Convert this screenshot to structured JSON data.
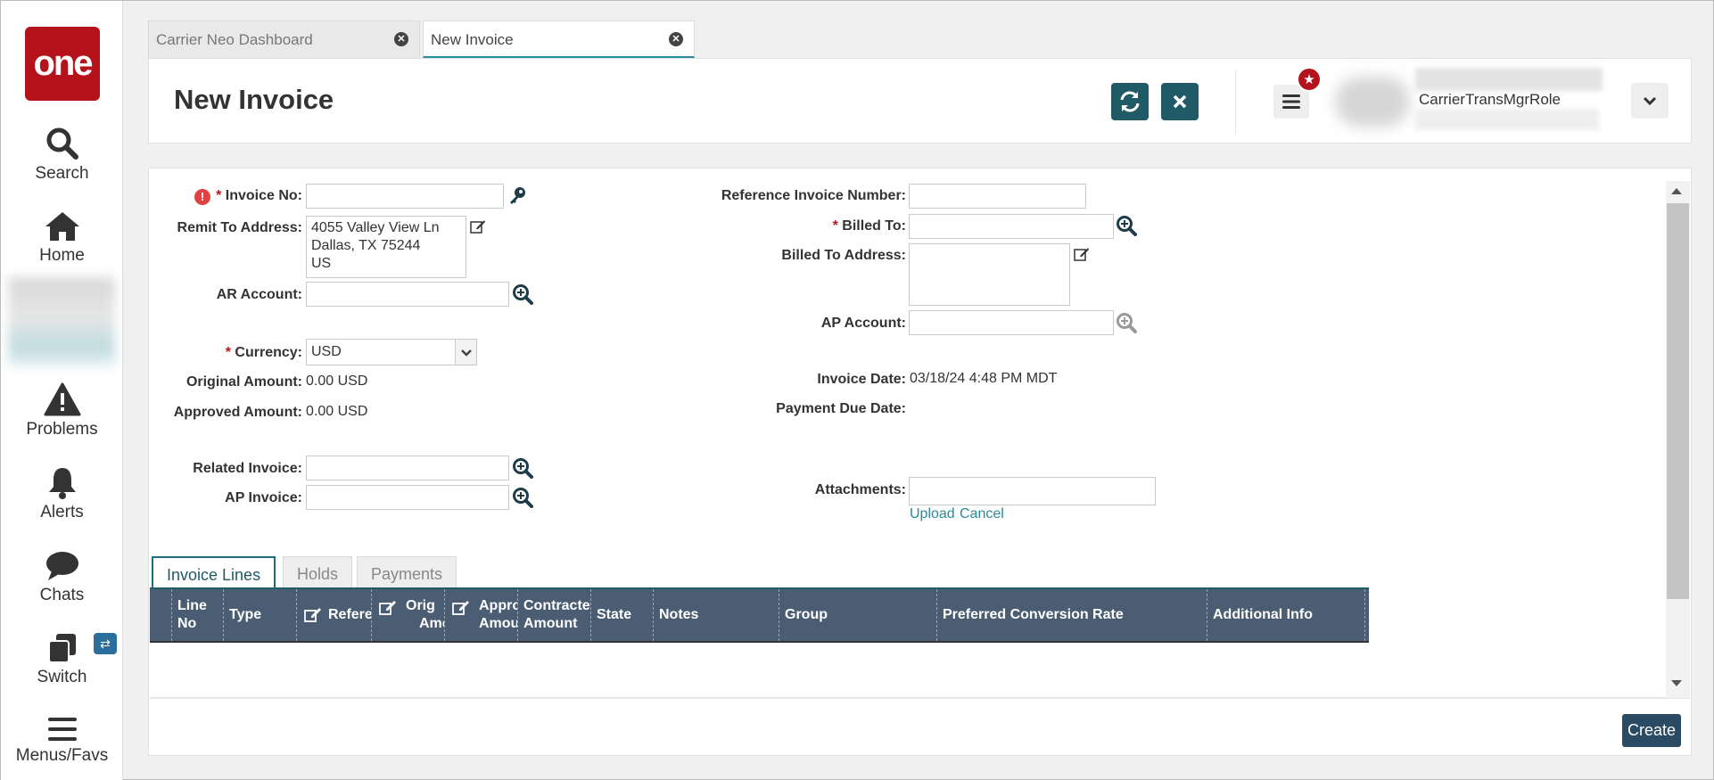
{
  "nav": {
    "logo": "one",
    "items": [
      {
        "label": "Search"
      },
      {
        "label": "Home"
      },
      {
        "label": "Problems"
      },
      {
        "label": "Alerts"
      },
      {
        "label": "Chats"
      },
      {
        "label": "Switch"
      },
      {
        "label": "Menus/Favs"
      }
    ]
  },
  "tabs": [
    {
      "label": "Carrier Neo Dashboard",
      "active": false
    },
    {
      "label": "New Invoice",
      "active": true
    }
  ],
  "header": {
    "title": "New Invoice",
    "role": "CarrierTransMgrRole"
  },
  "form": {
    "invoice_no": {
      "label": "Invoice No:",
      "value": ""
    },
    "remit_to_address": {
      "label": "Remit To Address:",
      "lines": [
        "4055 Valley View Ln",
        "Dallas, TX 75244",
        "US"
      ]
    },
    "ar_account": {
      "label": "AR Account:",
      "value": ""
    },
    "currency": {
      "label": "Currency:",
      "value": "USD"
    },
    "original_amount": {
      "label": "Original Amount:",
      "value": "0.00",
      "unit": "USD"
    },
    "approved_amount": {
      "label": "Approved Amount:",
      "value": "0.00",
      "unit": "USD"
    },
    "related_invoice": {
      "label": "Related Invoice:",
      "value": ""
    },
    "ap_invoice": {
      "label": "AP Invoice:",
      "value": ""
    },
    "reference_invoice_number": {
      "label": "Reference Invoice Number:",
      "value": ""
    },
    "billed_to": {
      "label": "Billed To:",
      "value": ""
    },
    "billed_to_address": {
      "label": "Billed To Address:",
      "value": ""
    },
    "ap_account": {
      "label": "AP Account:",
      "value": ""
    },
    "invoice_date": {
      "label": "Invoice Date:",
      "value": "03/18/24 4:48 PM MDT"
    },
    "payment_due_date": {
      "label": "Payment Due Date:",
      "value": ""
    },
    "attachments": {
      "label": "Attachments:",
      "upload": "Upload",
      "cancel": "Cancel"
    }
  },
  "bottom_tabs": [
    {
      "label": "Invoice Lines",
      "active": true
    },
    {
      "label": "Holds",
      "active": false
    },
    {
      "label": "Payments",
      "active": false
    }
  ],
  "grid": {
    "columns": [
      {
        "line1": "Line",
        "line2": "No"
      },
      {
        "line1": "Type",
        "line2": ""
      },
      {
        "line1": "Refere",
        "line2": ""
      },
      {
        "line1": "Orig",
        "line2": "Amou"
      },
      {
        "line1": "Appro",
        "line2": "Amou"
      },
      {
        "line1": "Contracte",
        "line2": "Amount"
      },
      {
        "line1": "State",
        "line2": ""
      },
      {
        "line1": "Notes",
        "line2": ""
      },
      {
        "line1": "Group",
        "line2": ""
      },
      {
        "line1": "Preferred Conversion Rate",
        "line2": ""
      },
      {
        "line1": "Additional Info",
        "line2": ""
      }
    ]
  },
  "actions": {
    "create": "Create"
  },
  "colors": {
    "brand_red": "#b5131c",
    "teal": "#1f5a66",
    "grid_header": "#4a5d72",
    "link": "#2a8b96"
  }
}
